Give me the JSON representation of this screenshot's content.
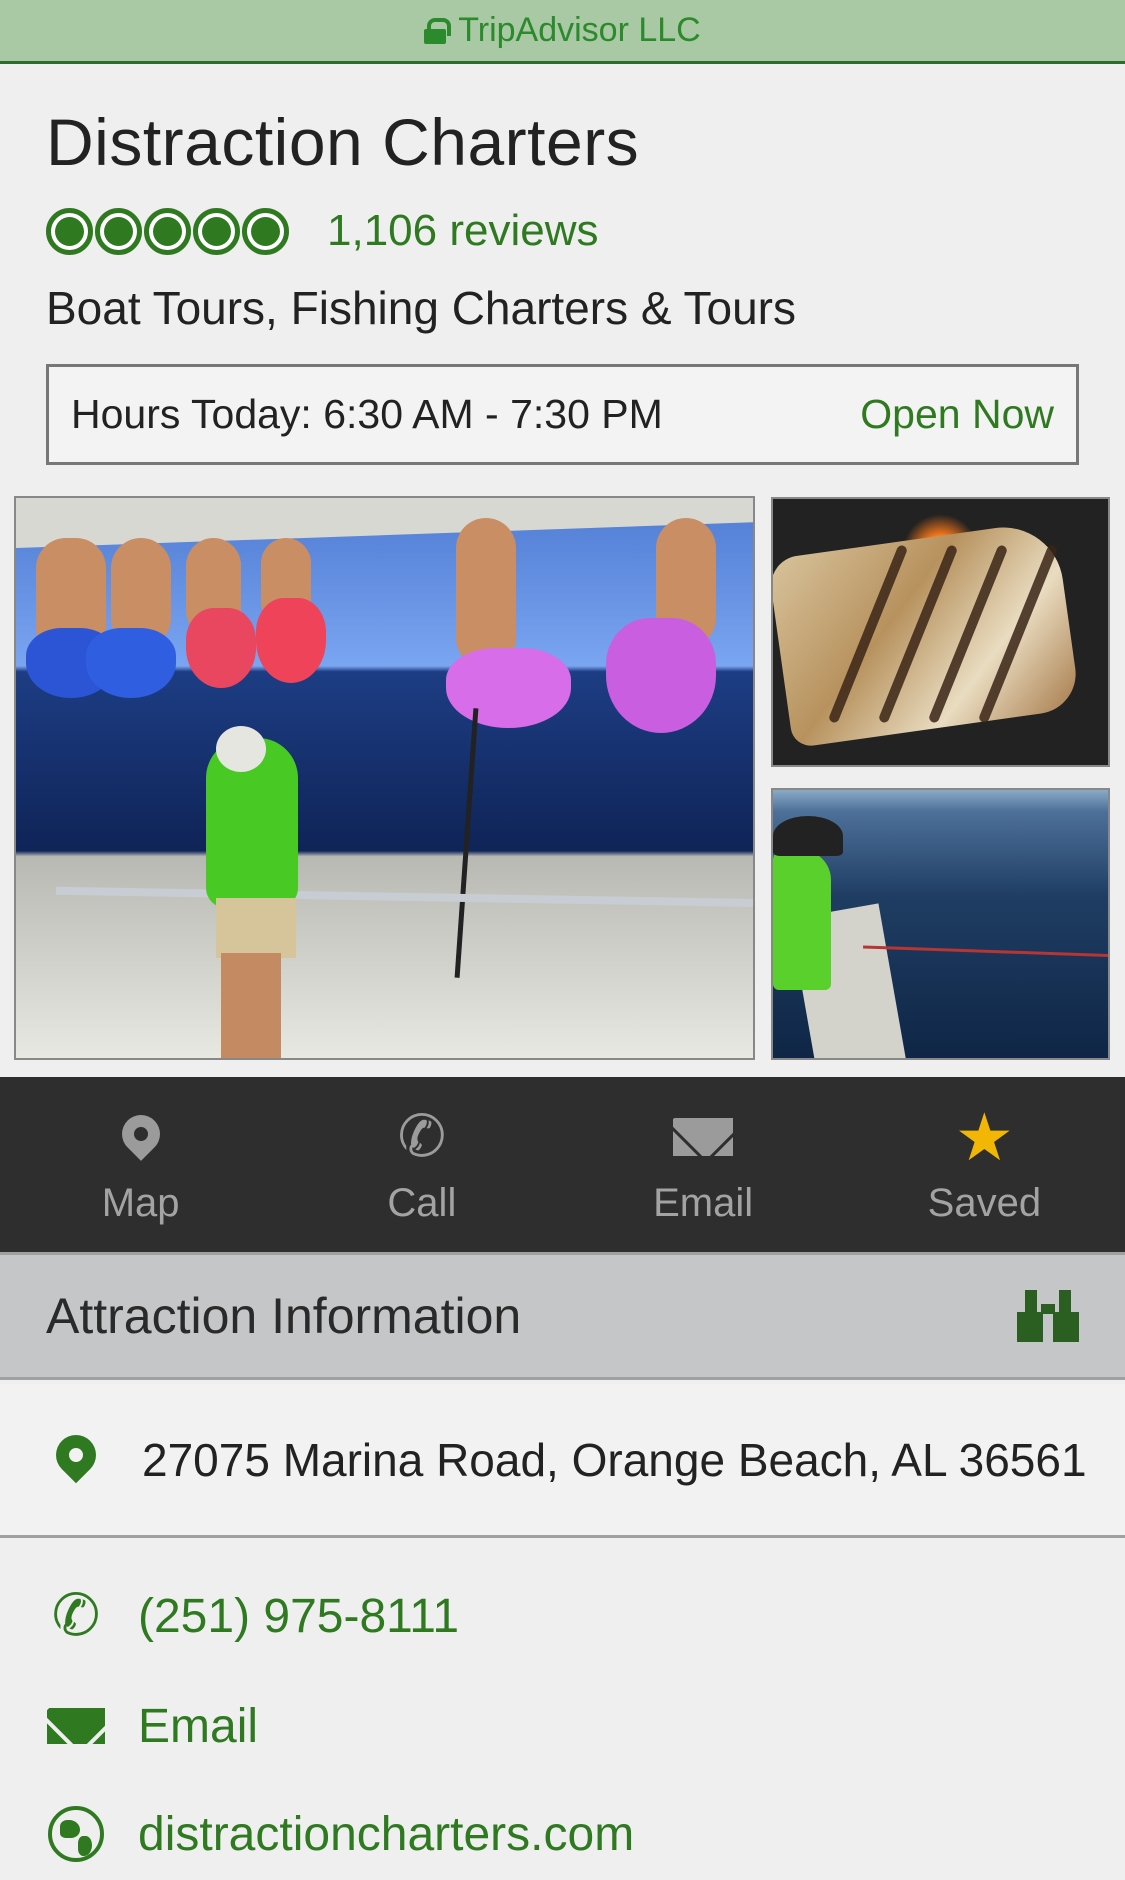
{
  "site_bar": {
    "site_name": "TripAdvisor LLC"
  },
  "header": {
    "title": "Distraction Charters",
    "rating_bubbles": 5,
    "reviews": "1,106 reviews",
    "categories": "Boat Tours, Fishing Charters & Tours"
  },
  "hours": {
    "text": "Hours Today: 6:30 AM - 7:30 PM",
    "status": "Open Now"
  },
  "actions": [
    {
      "label": "Map",
      "icon": "map-pin-icon"
    },
    {
      "label": "Call",
      "icon": "phone-icon"
    },
    {
      "label": "Email",
      "icon": "mail-icon"
    },
    {
      "label": "Saved",
      "icon": "star-icon"
    }
  ],
  "section": {
    "title": "Attraction Information",
    "icon": "binoculars-icon"
  },
  "info": {
    "address": "27075 Marina Road, Orange Beach, AL 36561",
    "phone": "(251) 975-8111",
    "email": "Email",
    "website": "distractioncharters.com"
  },
  "colors": {
    "brand_green": "#2f7a21",
    "site_bar": "#a9c8a4",
    "action_bar": "#2e2e2e",
    "saved_star": "#f2b705"
  }
}
